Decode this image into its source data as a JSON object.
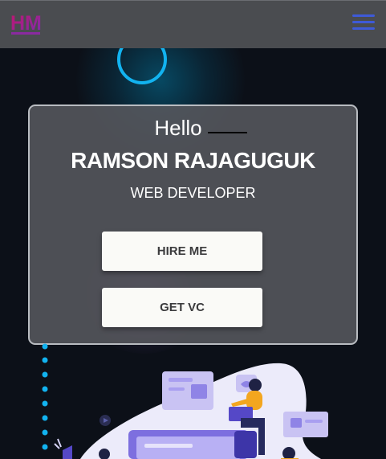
{
  "header": {
    "logo_text": "HM",
    "menu_icon": "hamburger-menu-icon",
    "accent_color": "#3e5ad8"
  },
  "hero": {
    "greeting": "Hello",
    "name": "RAMSON RAJAGUGUK",
    "role": "WEB DEVELOPER",
    "buttons": {
      "hire": "HIRE ME",
      "cv": "GET VC"
    }
  },
  "decor": {
    "ring_color": "#12b3f0",
    "dot_color": "#12b3f0"
  }
}
